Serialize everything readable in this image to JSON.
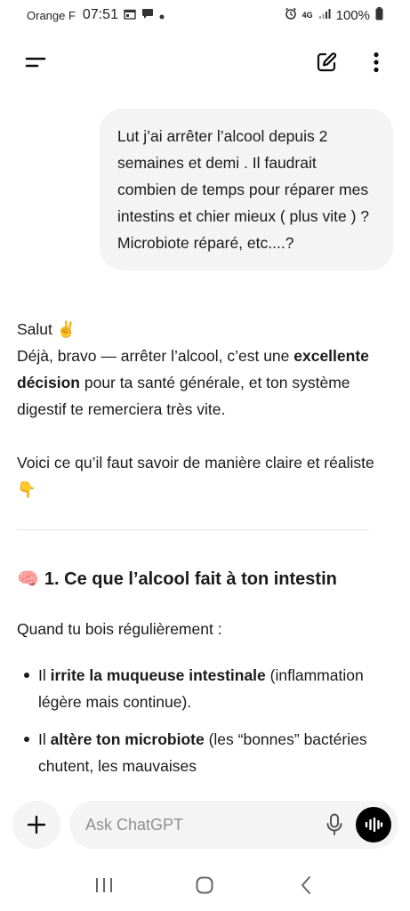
{
  "status_bar": {
    "carrier": "Orange F",
    "time": "07:51",
    "network": "4G",
    "battery": "100%"
  },
  "header": {
    "menu_icon": "menu-icon",
    "new_chat_icon": "new-chat-icon",
    "more_icon": "more-vertical-icon"
  },
  "conversation": {
    "user_message": "Lut j’ai arrêter l’alcool depuis 2 semaines et demi . Il faudrait combien de temps pour réparer mes intestins et chier mieux ( plus vite ) ? Microbiote réparé, etc....?",
    "assistant": {
      "greeting": "Salut ✌️",
      "p1_part1": "Déjà, bravo — arrêter l’alcool, c’est une ",
      "p1_bold": "excellente décision",
      "p1_part2": " pour ta santé générale, et ton système digestif te remerciera très vite.",
      "p2": "Voici ce qu’il faut savoir de manière claire et réaliste 👇",
      "section_emoji": "🧠",
      "section_title": "1. Ce que l’alcool fait à ton intestin",
      "intro": "Quand tu bois régulièrement :",
      "bullets": [
        {
          "prefix": "Il ",
          "bold": "irrite la muqueuse intestinale",
          "suffix": " (inflammation légère mais continue)."
        },
        {
          "prefix": "Il ",
          "bold": "altère ton microbiote",
          "suffix": " (les “bonnes” bactéries chutent, les mauvaises"
        }
      ]
    }
  },
  "composer": {
    "placeholder": "Ask ChatGPT"
  },
  "colors": {
    "bubble": "#f4f4f4",
    "text": "#1a1a1a",
    "voice_button": "#000000"
  }
}
